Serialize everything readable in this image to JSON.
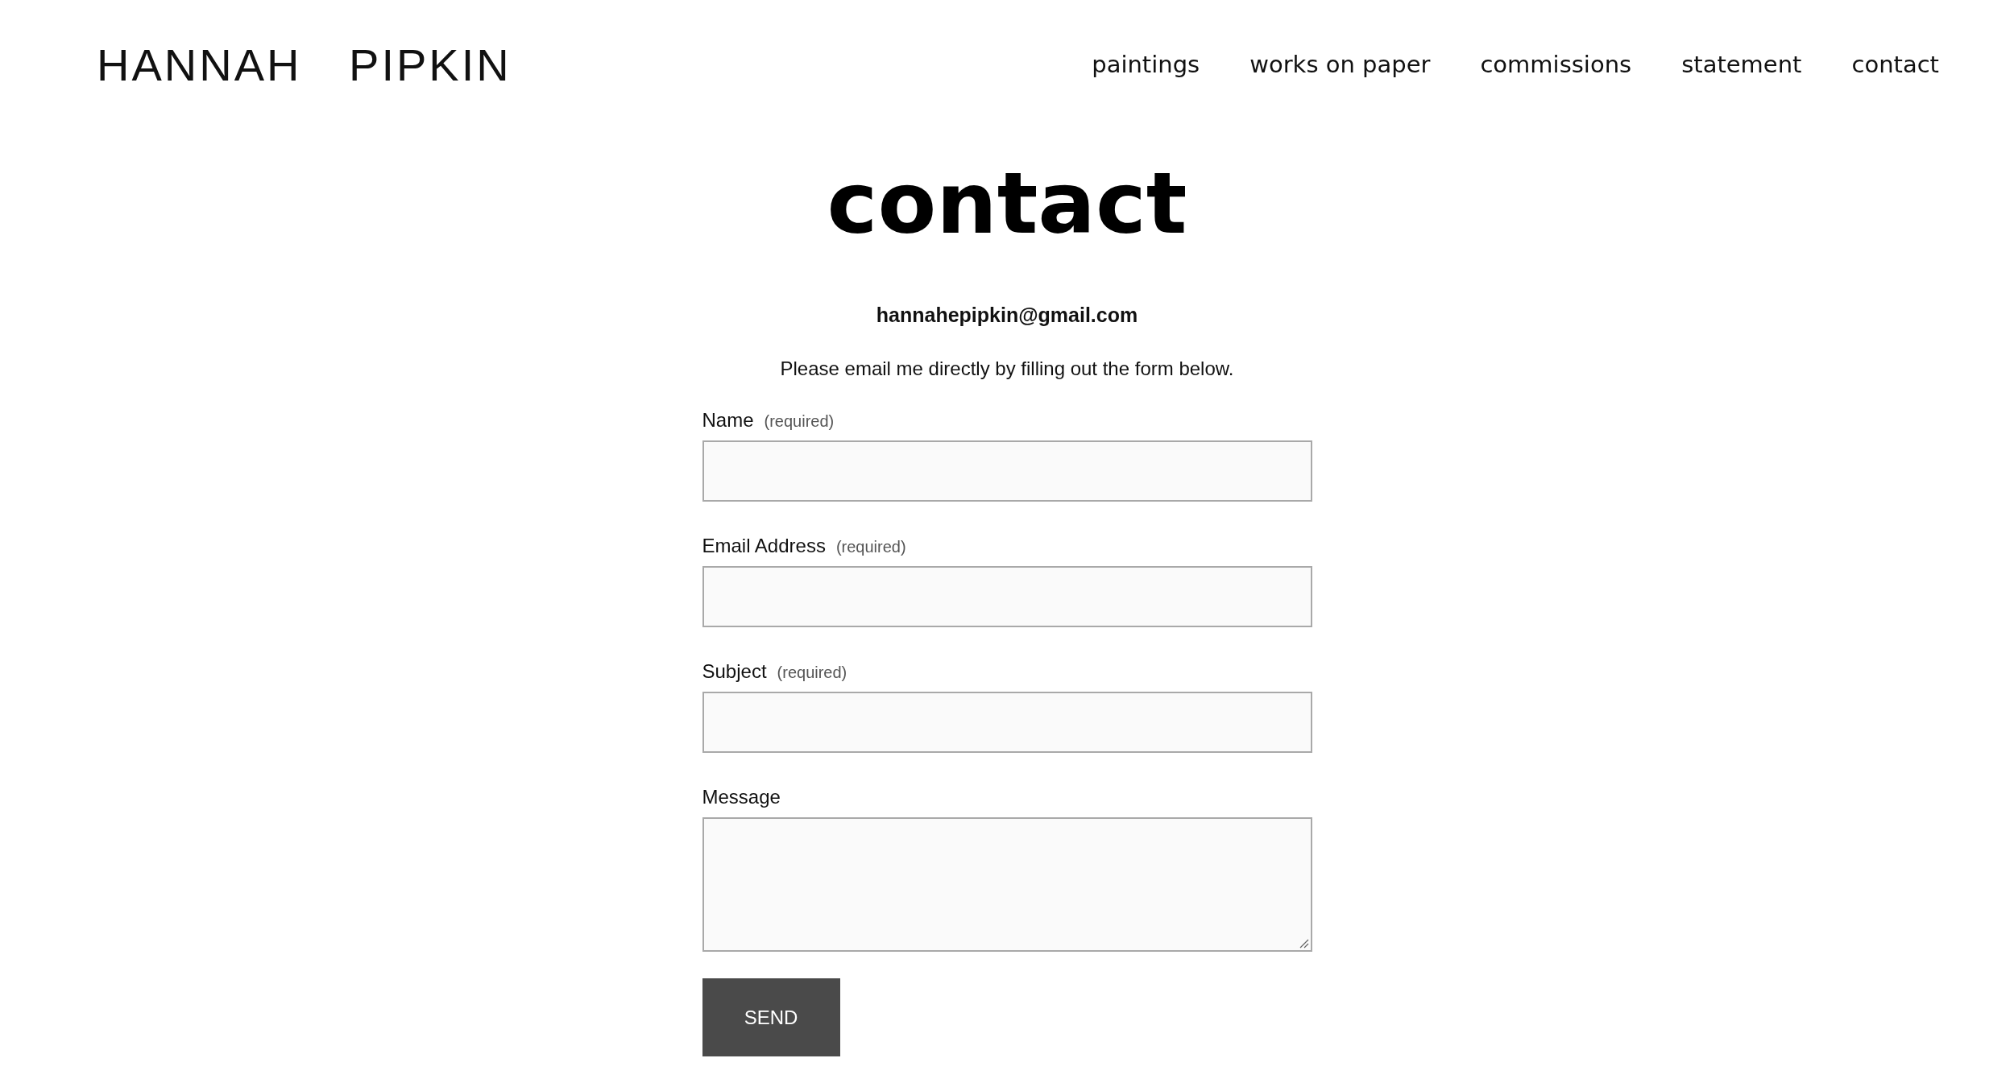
{
  "header": {
    "logo": "HANNAH PIPKIN",
    "nav": [
      "paintings",
      "works on paper",
      "commissions",
      "statement",
      "contact"
    ]
  },
  "page": {
    "heading": "contact",
    "email": "hannahepipkin@gmail.com",
    "intro": "Please email me directly by filling out the form below."
  },
  "form": {
    "fields": [
      {
        "kind": "input",
        "label": "Name",
        "required_note": "(required)"
      },
      {
        "kind": "input",
        "label": "Email Address",
        "required_note": "(required)"
      },
      {
        "kind": "input",
        "label": "Subject",
        "required_note": "(required)"
      },
      {
        "kind": "textarea",
        "label": "Message"
      }
    ],
    "submit": "SEND"
  }
}
